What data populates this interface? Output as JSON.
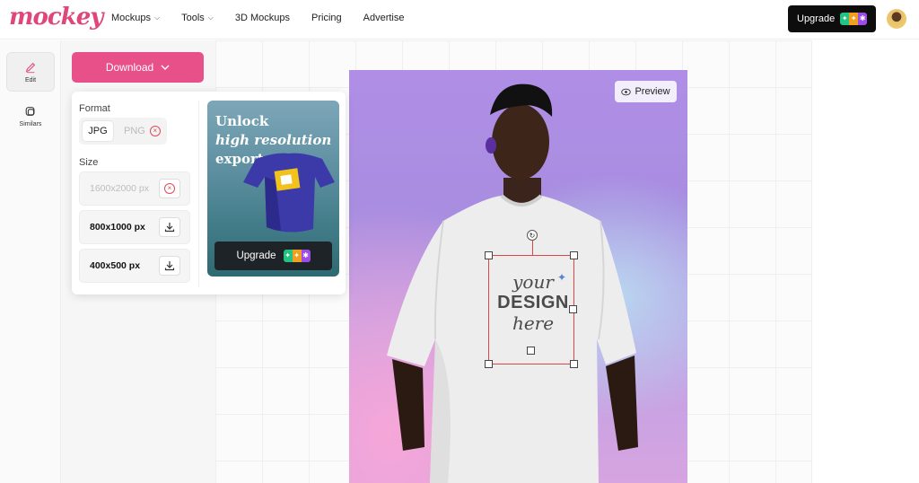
{
  "brand": {
    "logo_text": "mockey",
    "accent": "#e8508a"
  },
  "nav": {
    "items": [
      {
        "label": "Mockups",
        "has_dropdown": true
      },
      {
        "label": "Tools",
        "has_dropdown": true
      },
      {
        "label": "3D Mockups",
        "has_dropdown": false
      },
      {
        "label": "Pricing",
        "has_dropdown": false
      },
      {
        "label": "Advertise",
        "has_dropdown": false
      }
    ],
    "upgrade_label": "Upgrade"
  },
  "rail": {
    "items": [
      {
        "label": "Edit",
        "icon": "pencil-icon",
        "active": true
      },
      {
        "label": "Similars",
        "icon": "similars-icon",
        "active": false
      }
    ]
  },
  "download": {
    "button_label": "Download",
    "format_label": "Format",
    "formats": [
      {
        "label": "JPG",
        "selected": true,
        "locked": false
      },
      {
        "label": "PNG",
        "selected": false,
        "locked": true
      }
    ],
    "size_label": "Size",
    "sizes": [
      {
        "label": "1600x2000 px",
        "locked": true
      },
      {
        "label": "800x1000 px",
        "locked": false
      },
      {
        "label": "400x500 px",
        "locked": false
      }
    ]
  },
  "promo": {
    "line1": "Unlock",
    "line2": "high resolution",
    "line3": "export",
    "upgrade_label": "Upgrade"
  },
  "canvas": {
    "preview_label": "Preview",
    "design_text": {
      "line1": "your",
      "line2": "DESIGN",
      "line3": "here"
    }
  }
}
